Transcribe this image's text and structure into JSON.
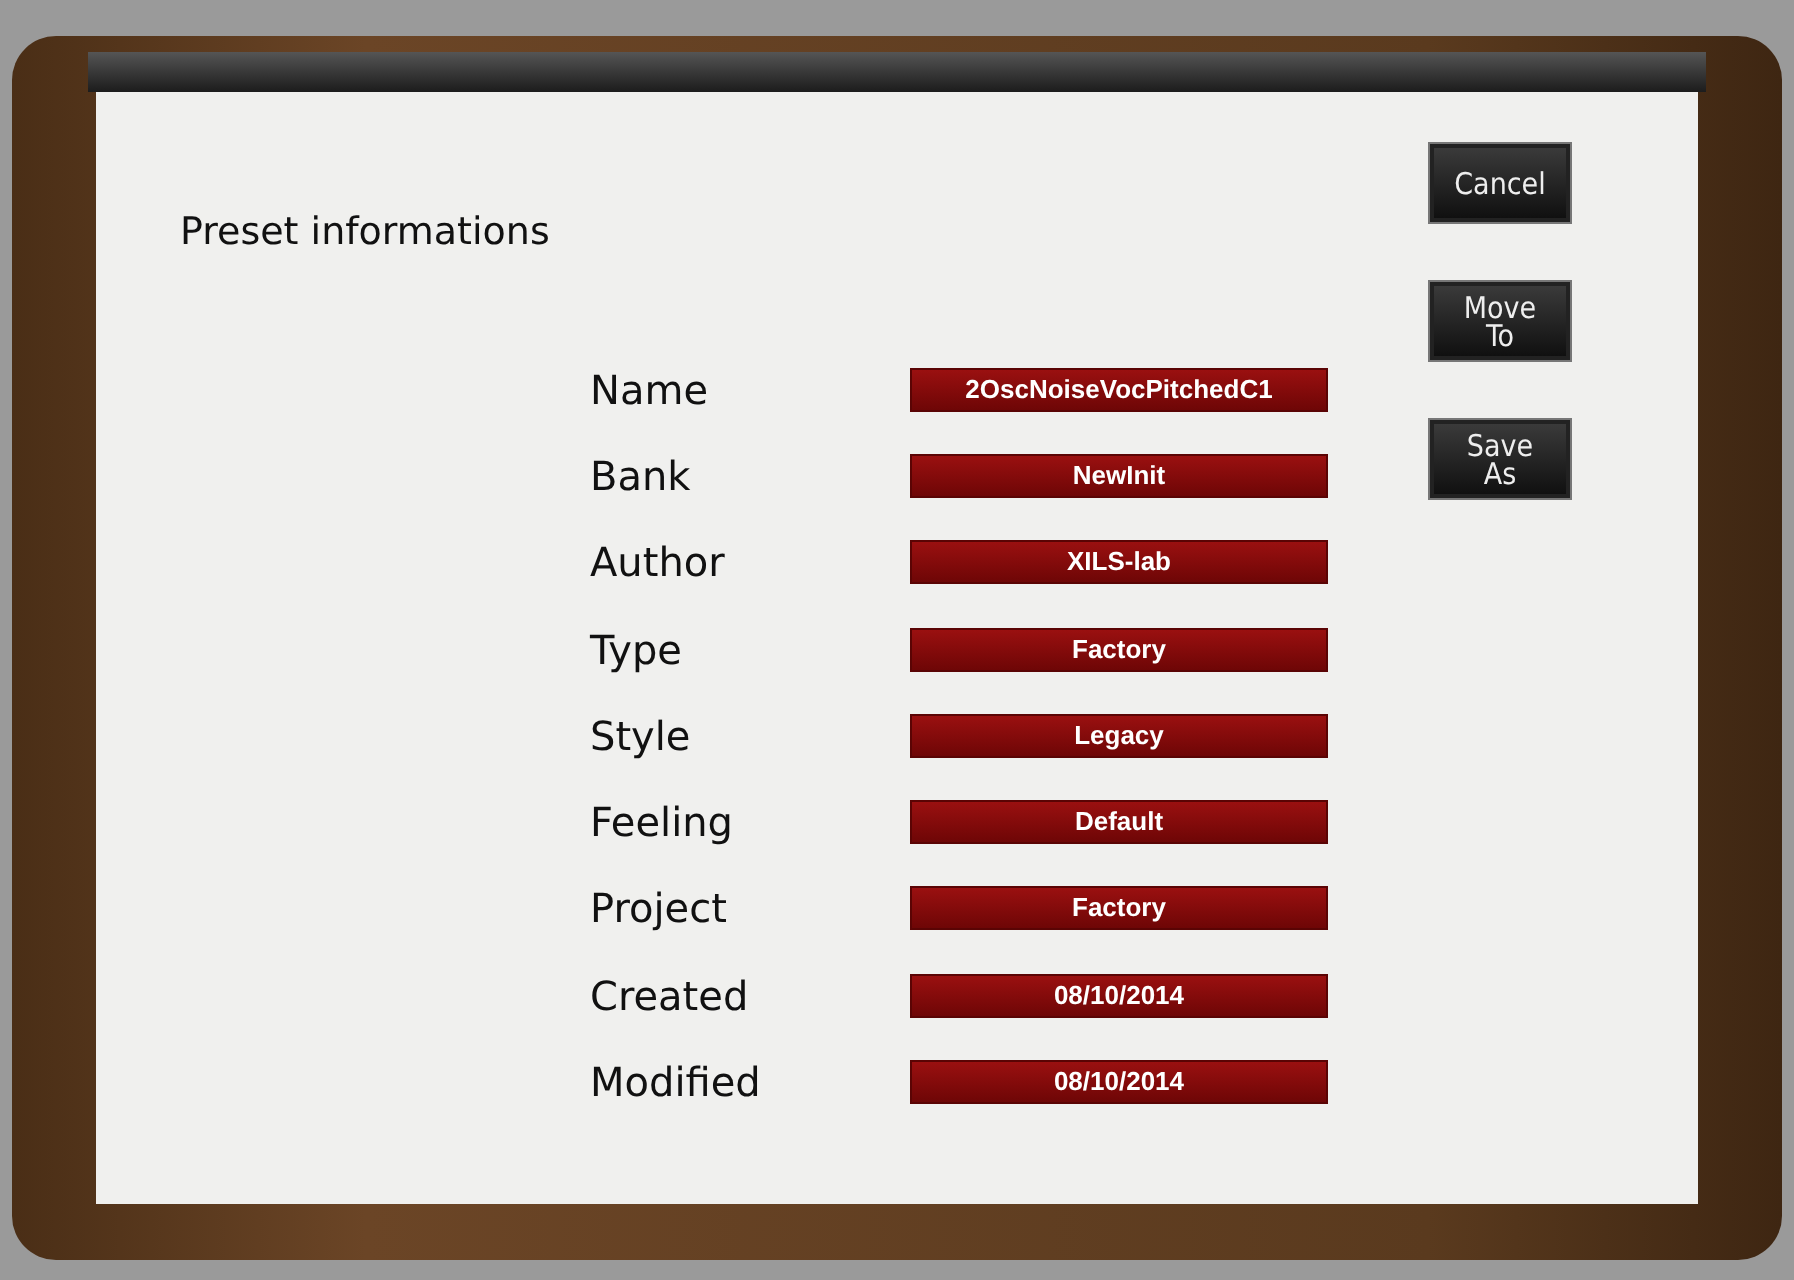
{
  "dialog": {
    "title": "Preset informations",
    "buttons": [
      {
        "lines": [
          "Cancel"
        ]
      },
      {
        "lines": [
          "Move",
          "To"
        ]
      },
      {
        "lines": [
          "Save",
          "As"
        ]
      }
    ],
    "fields": [
      {
        "label": "Name",
        "value": "2OscNoiseVocPitchedC1"
      },
      {
        "label": "Bank",
        "value": "NewInit"
      },
      {
        "label": "Author",
        "value": "XILS-lab"
      },
      {
        "label": "Type",
        "value": "Factory"
      },
      {
        "label": "Style",
        "value": "Legacy"
      },
      {
        "label": "Feeling",
        "value": "Default"
      },
      {
        "label": "Project",
        "value": "Factory"
      },
      {
        "label": "Created",
        "value": "08/10/2014"
      },
      {
        "label": "Modified",
        "value": "08/10/2014"
      }
    ]
  }
}
